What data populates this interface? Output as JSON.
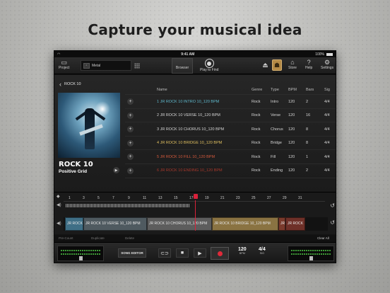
{
  "headline": "Capture your musical idea",
  "status_bar": {
    "time": "9:41 AM",
    "battery": "100%"
  },
  "toolbar": {
    "project_label": "Project",
    "preset_name": "Metal",
    "browser_label": "Browser",
    "play_to_find_label": "Play to Find",
    "store_label": "Store",
    "help_label": "Help",
    "settings_label": "Settings"
  },
  "browser": {
    "back_label": "ROCK 10",
    "album_title": "ROCK 10",
    "album_artist": "Positive Grid",
    "columns": {
      "name": "Name",
      "genre": "Genre",
      "type": "Type",
      "bpm": "BPM",
      "bars": "Bars",
      "sig": "Sig"
    },
    "rows": [
      {
        "name": "1 JR ROCK 10 INTRO 10_120 BPM",
        "genre": "Rock",
        "type": "Intro",
        "bpm": "120",
        "bars": "2",
        "sig": "4/4",
        "color": "#5fb8cc"
      },
      {
        "name": "2 JR ROCK 10 VERSE 10_120 BPM",
        "genre": "Rock",
        "type": "Verse",
        "bpm": "120",
        "bars": "16",
        "sig": "4/4",
        "color": "#d6d6d6"
      },
      {
        "name": "3 JR ROCK 10 CHORUS 10_120 BPM",
        "genre": "Rock",
        "type": "Chorus",
        "bpm": "120",
        "bars": "8",
        "sig": "4/4",
        "color": "#d6d6d6"
      },
      {
        "name": "4 JR ROCK 10 BRIDGE 10_120 BPM",
        "genre": "Rock",
        "type": "Bridge",
        "bpm": "120",
        "bars": "8",
        "sig": "4/4",
        "color": "#e0c060"
      },
      {
        "name": "5 JR ROCK 10 FILL 10_120 BPM",
        "genre": "Rock",
        "type": "Fill",
        "bpm": "120",
        "bars": "1",
        "sig": "4/4",
        "color": "#d65a3c"
      },
      {
        "name": "6 JR ROCK 10 ENDING 10_120 BPM",
        "genre": "Rock",
        "type": "Ending",
        "bpm": "120",
        "bars": "2",
        "sig": "4/4",
        "color": "#a8382c"
      }
    ]
  },
  "timeline": {
    "bars": [
      "1",
      "3",
      "5",
      "7",
      "9",
      "11",
      "13",
      "15",
      "17",
      "19",
      "21",
      "23",
      "25",
      "27",
      "29",
      "31"
    ],
    "clips": [
      {
        "label": "JR ROCK",
        "color": "#3f6f86"
      },
      {
        "label": "JR ROCK 10 VERSE 10_120 BPM",
        "color": "#4f5a60"
      },
      {
        "label": "JR ROCK 10 CHORUS 10_120 BPM",
        "color": "#5d5d5d"
      },
      {
        "label": "JR ROCK 10 BRIDGE 10_120 BPM",
        "color": "#8a7342"
      },
      {
        "label": "JR",
        "color": "#7a3a2c"
      },
      {
        "label": "JR ROCK",
        "color": "#6e3028"
      }
    ]
  },
  "edit_bar": {
    "pre_count": "Pre-Count",
    "duplicate": "Duplicate",
    "delete": "Delete",
    "clear_all": "Clear All"
  },
  "transport": {
    "song_editor_label": "SONG EDITOR",
    "bpm_value": "120",
    "bpm_unit": "BPM",
    "sig_value": "4/4",
    "sig_unit": "SIG"
  }
}
